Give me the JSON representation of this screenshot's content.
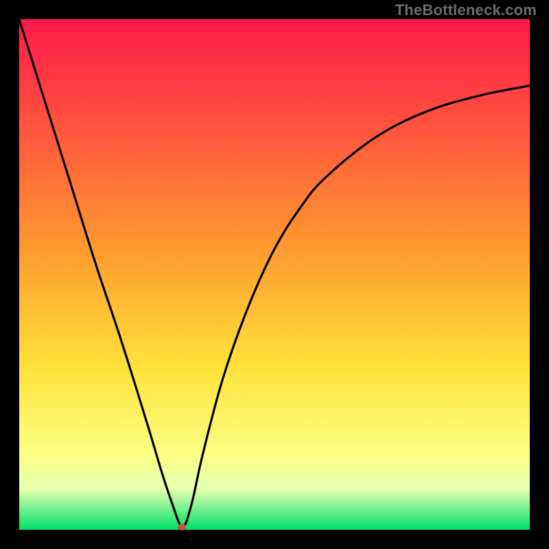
{
  "watermark": {
    "text": "TheBottleneck.com"
  },
  "colors": {
    "outer_bg": "#000000",
    "watermark": "#6b6b6b",
    "curve": "#000000",
    "marker": "#c9524a",
    "gradient_top": "#ff1a4b",
    "gradient_mid_red": "#ff4b3f",
    "gradient_orange": "#ff9a2f",
    "gradient_yellow": "#ffe23a",
    "gradient_light": "#fcff82",
    "gradient_pale": "#e6ffb0",
    "gradient_green": "#00e06a"
  },
  "chart_data": {
    "type": "line",
    "title": "",
    "xlabel": "",
    "ylabel": "",
    "xlim": [
      0,
      100
    ],
    "ylim": [
      0,
      100
    ],
    "series": [
      {
        "name": "bottleneck-curve",
        "x": [
          0,
          5,
          10,
          15,
          20,
          25,
          28,
          30,
          31.5,
          32.5,
          34,
          36,
          40,
          45,
          50,
          55,
          60,
          70,
          80,
          90,
          100
        ],
        "y": [
          100,
          84,
          68,
          52,
          37,
          21,
          11,
          5,
          1,
          1,
          6,
          15,
          30,
          44,
          55,
          63,
          69,
          77,
          82,
          85,
          87
        ]
      }
    ],
    "marker": {
      "x": 31.8,
      "y": 0.5,
      "color": "#c9524a"
    },
    "background_gradient": {
      "direction": "vertical",
      "stops": [
        {
          "pos": 0.0,
          "color": "#ff1a4b"
        },
        {
          "pos": 0.18,
          "color": "#ff4b3f"
        },
        {
          "pos": 0.45,
          "color": "#ff9a2f"
        },
        {
          "pos": 0.68,
          "color": "#ffe23a"
        },
        {
          "pos": 0.85,
          "color": "#fcff82"
        },
        {
          "pos": 0.92,
          "color": "#e6ffb0"
        },
        {
          "pos": 1.0,
          "color": "#00e06a"
        }
      ]
    }
  }
}
